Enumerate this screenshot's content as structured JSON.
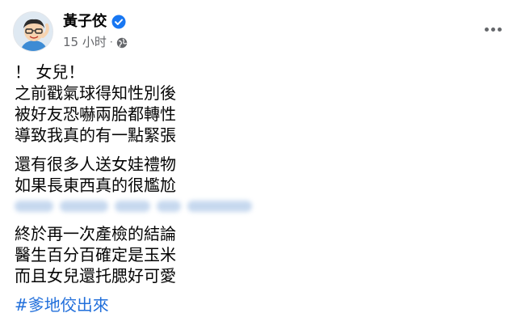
{
  "author": {
    "name": "黃子佼",
    "verified_icon": "verified-badge-icon",
    "avatar_icon": "cartoon-avatar-icon"
  },
  "meta": {
    "time": "15 小时",
    "separator": "·",
    "privacy_icon": "globe-icon"
  },
  "menu": {
    "icon": "more-horizontal-icon"
  },
  "post": {
    "line1": "！ 女兒！",
    "para1": [
      "之前戳氣球得知性別後",
      "被好友恐嚇兩胎都轉性",
      "導致我真的有一點緊張"
    ],
    "para2": [
      "還有很多人送女娃禮物",
      "如果長東西真的很尷尬"
    ],
    "para3": [
      "終於再一次產檢的結論",
      "醫生百分百確定是玉米",
      "而且女兒還托腮好可愛"
    ],
    "hashtag": "#爹地佼出來"
  },
  "colors": {
    "text": "#050505",
    "secondary": "#65676b",
    "link": "#216fdb",
    "verified": "#1877f2"
  }
}
